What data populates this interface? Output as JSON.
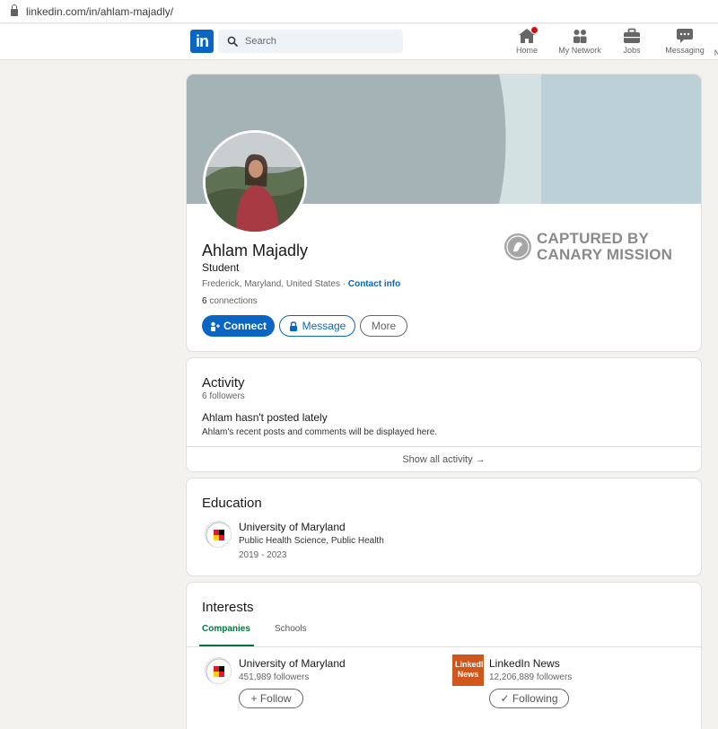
{
  "browser": {
    "url": "linkedin.com/in/ahlam-majadly/"
  },
  "nav": {
    "logo": "in",
    "search_placeholder": "Search",
    "items": [
      {
        "label": "Home",
        "icon": "home-icon"
      },
      {
        "label": "My Network",
        "icon": "network-icon"
      },
      {
        "label": "Jobs",
        "icon": "briefcase-icon"
      },
      {
        "label": "Messaging",
        "icon": "messaging-icon"
      }
    ],
    "overflow_label": "N"
  },
  "profile": {
    "name": "Ahlam Majadly",
    "headline": "Student",
    "location": "Frederick, Maryland, United States",
    "separator": "·",
    "contact_info": "Contact info",
    "connections_count": "6",
    "connections_label": "connections",
    "actions": {
      "connect": "Connect",
      "message": "Message",
      "more": "More"
    }
  },
  "watermark": {
    "line1": "CAPTURED BY",
    "line2": "CANARY MISSION"
  },
  "activity": {
    "title": "Activity",
    "followers": "6 followers",
    "empty_title": "Ahlam hasn't posted lately",
    "empty_desc": "Ahlam's recent posts and comments will be displayed here.",
    "show_all": "Show all activity →"
  },
  "education": {
    "title": "Education",
    "entries": [
      {
        "school": "University of Maryland",
        "degree": "Public Health Science, Public Health",
        "dates": "2019 - 2023"
      }
    ]
  },
  "interests": {
    "title": "Interests",
    "tabs": [
      "Companies",
      "Schools"
    ],
    "items": [
      {
        "name": "University of Maryland",
        "followers": "451,989 followers",
        "button": "+ Follow"
      },
      {
        "name": "LinkedIn News",
        "followers": "12,206,889 followers",
        "button": "✓ Following",
        "logo_text": "LinkedIn News"
      }
    ]
  },
  "colors": {
    "brand": "#0a66c2",
    "accent_green": "#057642",
    "banner": "#a1b1b5",
    "news_logo": "#d0561c"
  }
}
